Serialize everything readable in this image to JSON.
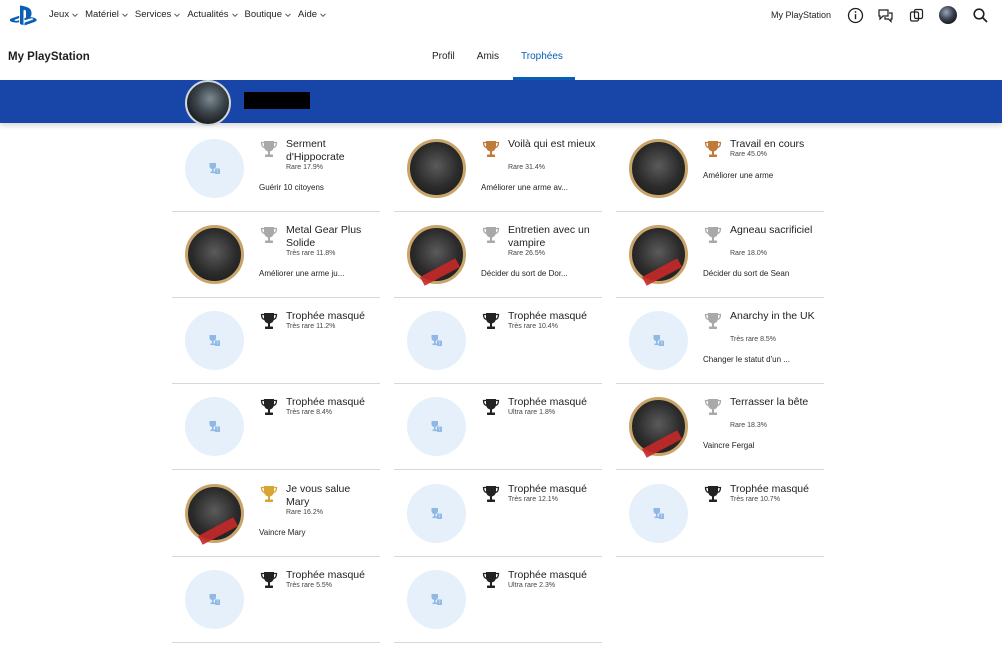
{
  "topnav": {
    "logo_icon": "playstation-logo-icon",
    "menu": [
      {
        "label": "Jeux"
      },
      {
        "label": "Matériel"
      },
      {
        "label": "Services"
      },
      {
        "label": "Actualités"
      },
      {
        "label": "Boutique"
      },
      {
        "label": "Aide"
      }
    ],
    "my_playstation": "My PlayStation",
    "icons": [
      "info-icon",
      "chat-icon",
      "notifications-icon",
      "avatar",
      "search-icon"
    ]
  },
  "subnav": {
    "site_title": "My PlayStation",
    "tabs": [
      {
        "label": "Profil",
        "active": false
      },
      {
        "label": "Amis",
        "active": false
      },
      {
        "label": "Trophées",
        "active": true
      }
    ],
    "accent": "#0a5fb4"
  },
  "banner": {
    "color": "#1846a8"
  },
  "trophies": [
    {
      "name": "Serment d'Hippocrate",
      "rarity": "Rare 17.9%",
      "desc": "Guérir 10 citoyens",
      "cup": "silver",
      "image": "hidden"
    },
    {
      "name": "Voilà qui est mieux",
      "rarity": "Rare 31.4%",
      "desc": "Améliorer une arme av...",
      "cup": "bronze",
      "image": "gun"
    },
    {
      "name": "Travail en cours",
      "rarity": "Rare 45.0%",
      "desc": "Améliorer une arme",
      "cup": "bronze",
      "image": "gun"
    },
    {
      "name": "Metal Gear Plus Solide",
      "rarity": "Très rare 11.8%",
      "desc": "Améliorer une arme ju...",
      "cup": "silver",
      "image": "gun"
    },
    {
      "name": "Entretien avec un vampire",
      "rarity": "Rare 26.5%",
      "desc": "Décider du sort de Dor...",
      "cup": "silver",
      "image": "portrait"
    },
    {
      "name": "Agneau sacrificiel",
      "rarity": "Rare 18.0%",
      "desc": "Décider du sort de Sean",
      "cup": "silver",
      "image": "portrait"
    },
    {
      "name": "Trophée masqué",
      "rarity": "Très rare 11.2%",
      "desc": "",
      "cup": "hidden",
      "image": "hidden"
    },
    {
      "name": "Trophée masqué",
      "rarity": "Très rare 10.4%",
      "desc": "",
      "cup": "hidden",
      "image": "hidden"
    },
    {
      "name": "Anarchy in the UK",
      "rarity": "Très rare 8.5%",
      "desc": "Changer le statut d'un ...",
      "cup": "silver",
      "image": "hidden"
    },
    {
      "name": "Trophée masqué",
      "rarity": "Très rare 8.4%",
      "desc": "",
      "cup": "hidden",
      "image": "hidden"
    },
    {
      "name": "Trophée masqué",
      "rarity": "Ultra rare 1.8%",
      "desc": "",
      "cup": "hidden",
      "image": "hidden"
    },
    {
      "name": "Terrasser la bête",
      "rarity": "Rare 18.3%",
      "desc": "Vaincre Fergal",
      "cup": "silver",
      "image": "portrait"
    },
    {
      "name": "Je vous salue Mary",
      "rarity": "Rare 16.2%",
      "desc": "Vaincre Mary",
      "cup": "gold",
      "image": "portrait"
    },
    {
      "name": "Trophée masqué",
      "rarity": "Très rare 12.1%",
      "desc": "",
      "cup": "hidden",
      "image": "hidden"
    },
    {
      "name": "Trophée masqué",
      "rarity": "Très rare 10.7%",
      "desc": "",
      "cup": "hidden",
      "image": "hidden"
    },
    {
      "name": "Trophée masqué",
      "rarity": "Très rare 5.5%",
      "desc": "",
      "cup": "hidden",
      "image": "hidden"
    },
    {
      "name": "Trophée masqué",
      "rarity": "Ultra rare 2.3%",
      "desc": "",
      "cup": "hidden",
      "image": "hidden"
    }
  ],
  "cup_colors": {
    "bronze": "#c07a3a",
    "silver": "#a9a9a9",
    "gold": "#d9a532",
    "hidden": "#222222"
  }
}
